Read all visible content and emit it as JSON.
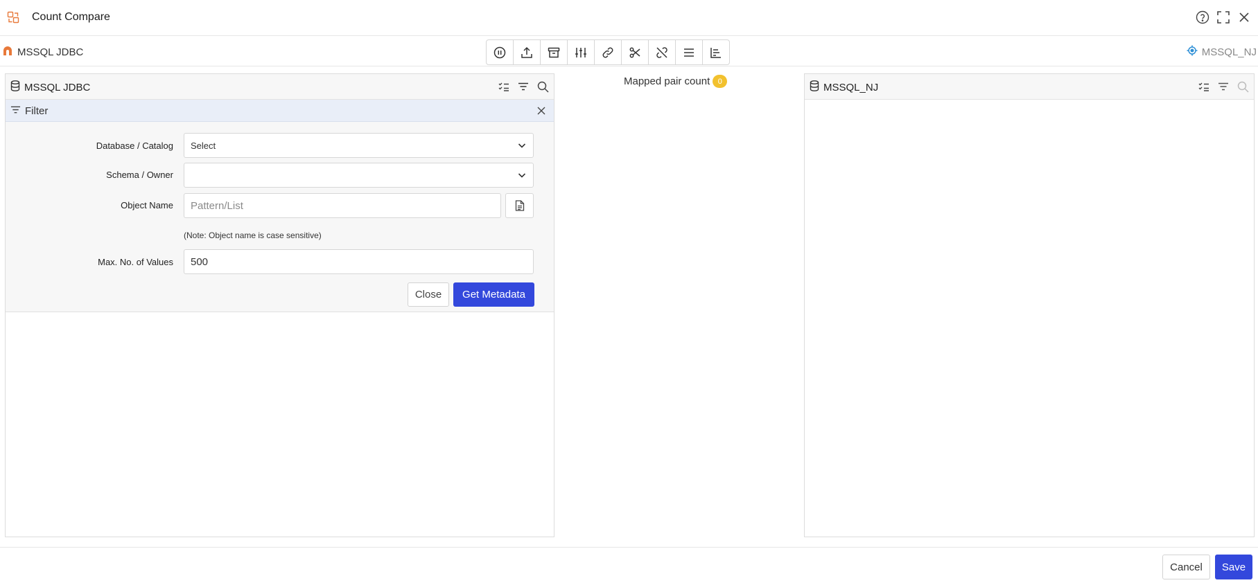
{
  "window": {
    "title": "Count Compare",
    "icons": [
      "app-logo-icon",
      "help-icon",
      "maximize-icon",
      "close-icon"
    ]
  },
  "toolbar": {
    "source_left": "MSSQL JDBC",
    "source_right": "MSSQL_NJ",
    "buttons": [
      {
        "name": "pause-icon"
      },
      {
        "name": "upload-icon"
      },
      {
        "name": "archive-icon"
      },
      {
        "name": "sliders-icon"
      },
      {
        "name": "link-icon"
      },
      {
        "name": "scissors-icon"
      },
      {
        "name": "unlink-icon"
      },
      {
        "name": "list-icon"
      },
      {
        "name": "chart-icon"
      }
    ]
  },
  "left_panel": {
    "title": "MSSQL JDBC",
    "filter": {
      "title": "Filter",
      "database_label": "Database / Catalog",
      "database_value": "Select",
      "schema_label": "Schema / Owner",
      "schema_value": "",
      "object_label": "Object Name",
      "object_placeholder": "Pattern/List",
      "note": "(Note: Object name is case sensitive)",
      "max_label": "Max. No. of Values",
      "max_value": "500",
      "close_label": "Close",
      "get_metadata_label": "Get Metadata"
    }
  },
  "center": {
    "mapped_label": "Mapped pair count",
    "mapped_count": "0"
  },
  "right_panel": {
    "title": "MSSQL_NJ"
  },
  "footer": {
    "cancel_label": "Cancel",
    "save_label": "Save"
  },
  "colors": {
    "primary": "#3348dc",
    "badge": "#f2c12e",
    "accent_orange": "#e8793a",
    "accent_blue": "#2e8fd6"
  }
}
